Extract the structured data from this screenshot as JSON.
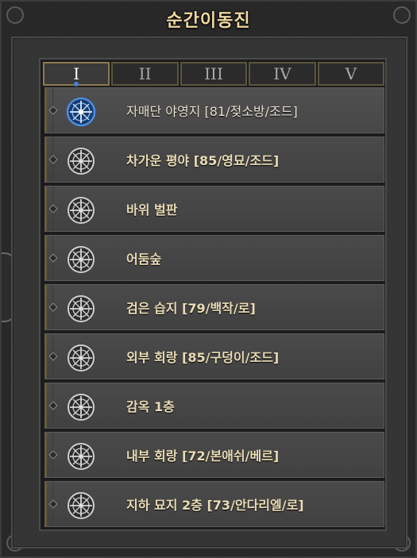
{
  "window": {
    "title": "순간이동진"
  },
  "tabs": [
    {
      "label": "I",
      "active": true
    },
    {
      "label": "II",
      "active": false
    },
    {
      "label": "III",
      "active": false
    },
    {
      "label": "IV",
      "active": false
    },
    {
      "label": "V",
      "active": false
    }
  ],
  "destinations": [
    {
      "label": "자매단 야영지 [81/젖소방/조드]",
      "icon": "teleport-rune-active-icon",
      "active": true
    },
    {
      "label": "차가운 평야 [85/영묘/조드]",
      "icon": "teleport-rune-icon",
      "active": false
    },
    {
      "label": "바위 벌판",
      "icon": "teleport-rune-icon",
      "active": false
    },
    {
      "label": "어둠숲",
      "icon": "teleport-rune-icon",
      "active": false
    },
    {
      "label": "검은 습지 [79/백작/로]",
      "icon": "teleport-rune-icon",
      "active": false
    },
    {
      "label": "외부 회랑 [85/구덩이/조드]",
      "icon": "teleport-rune-icon",
      "active": false
    },
    {
      "label": "감옥 1층",
      "icon": "teleport-rune-icon",
      "active": false
    },
    {
      "label": "내부 회랑 [72/본애쉬/베르]",
      "icon": "teleport-rune-icon",
      "active": false
    },
    {
      "label": "지하 묘지 2층 [73/안다리엘/로]",
      "icon": "teleport-rune-icon",
      "active": false
    }
  ],
  "colors": {
    "title": "#f0d8a0",
    "label": "#eadcb6",
    "active_icon": "#4a8ee8",
    "inactive_icon": "#d0d0d0"
  }
}
